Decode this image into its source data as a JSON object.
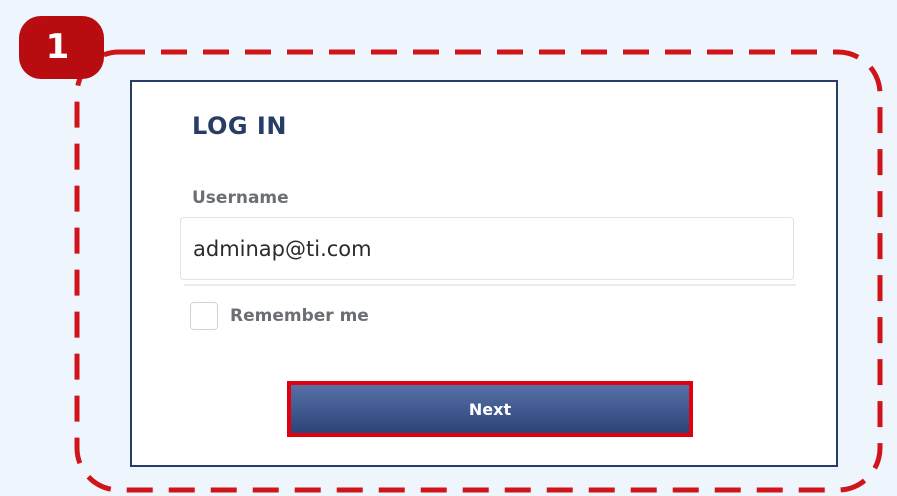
{
  "step": {
    "number": "1",
    "color": "#b80c10"
  },
  "highlight": {
    "color": "#d0141a"
  },
  "login": {
    "title": "LOG IN",
    "username_label": "Username",
    "username_value": "adminap@ti.com",
    "remember_label": "Remember me",
    "remember_checked": false,
    "next_label": "Next"
  },
  "colors": {
    "page_background": "#eef5fc",
    "title": "#273d68",
    "button": "#3b5288"
  }
}
